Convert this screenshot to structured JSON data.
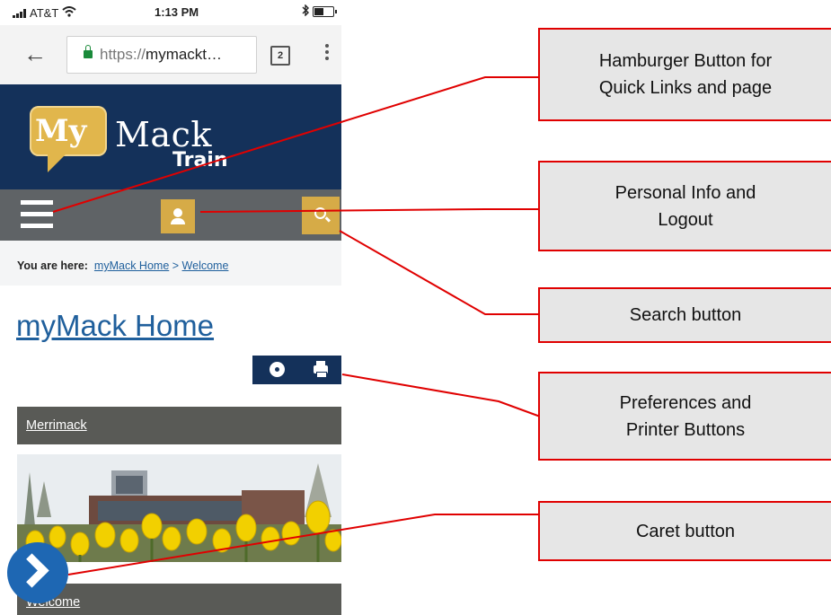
{
  "status_bar": {
    "carrier": "AT&T",
    "time": "1:13 PM"
  },
  "browser": {
    "url_scheme": "https://",
    "url_host": "mymackt…",
    "tab_count": "2"
  },
  "site": {
    "logo_my": "My",
    "logo_mack": "Mack",
    "logo_train": "Train"
  },
  "breadcrumb": {
    "label": "You are here:",
    "home": "myMack Home",
    "separator": ">",
    "current": "Welcome"
  },
  "page": {
    "title": "myMack Home",
    "section_merrimack": "Merrimack",
    "section_bottom": "Welcome"
  },
  "callouts": {
    "hamburger": [
      "Hamburger Button for",
      "Quick Links and page"
    ],
    "personal": [
      "Personal Info and",
      "Logout"
    ],
    "search": [
      "Search button"
    ],
    "prefs": [
      "Preferences and",
      "Printer Buttons"
    ],
    "caret": [
      "Caret button"
    ]
  },
  "colors": {
    "header_navy": "#14315a",
    "nav_gray": "#5f6366",
    "gold": "#d6ab47",
    "link_blue": "#1f5f9c",
    "callout_border": "#e00000",
    "callout_fill": "#e6e6e6"
  },
  "icons": {
    "signal": "signal-icon",
    "wifi": "wifi-icon",
    "bluetooth": "bluetooth-icon",
    "battery": "battery-icon",
    "back": "back-arrow-icon",
    "lock": "lock-icon",
    "menu": "hamburger-icon",
    "person": "person-icon",
    "search": "search-icon",
    "gear": "gear-icon",
    "printer": "printer-icon",
    "caret": "chevron-right-icon"
  }
}
